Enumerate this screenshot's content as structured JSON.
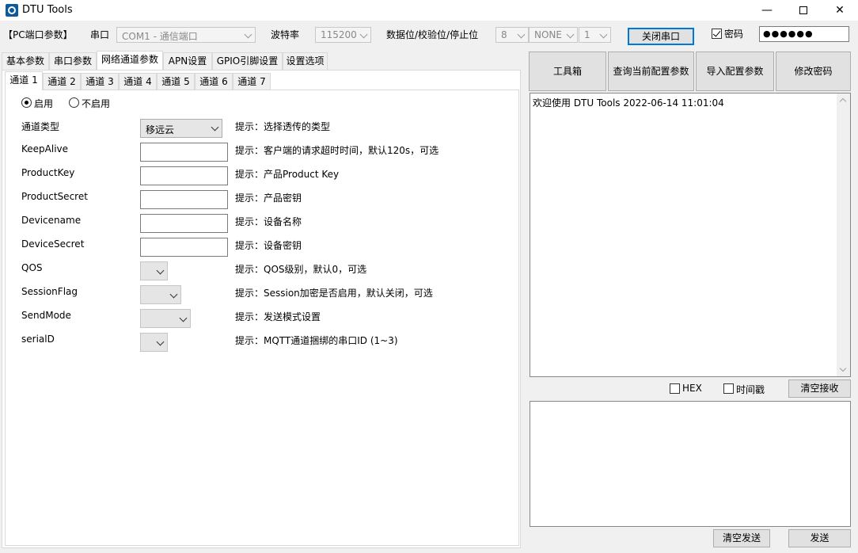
{
  "window": {
    "title": "DTU Tools"
  },
  "pc_port": {
    "section_label": "【PC端口参数】",
    "port_label": "串口",
    "port_value": "COM1 - 通信端口",
    "baud_label": "波特率",
    "baud_value": "115200",
    "format_label": "数据位/校验位/停止位",
    "data_bits": "8",
    "parity": "NONE",
    "stop_bits": "1",
    "close_port_button": "关闭串口",
    "password_checkbox_label": "密码",
    "password_checked": true,
    "password_value": "●●●●●●"
  },
  "main_tabs": [
    "基本参数",
    "串口参数",
    "网络通道参数",
    "APN设置",
    "GPIO引脚设置",
    "设置选项"
  ],
  "main_tab_selected": 2,
  "channel_tabs": [
    "通道 1",
    "通道 2",
    "通道 3",
    "通道 4",
    "通道 5",
    "通道 6",
    "通道 7"
  ],
  "channel_tab_selected": 0,
  "enable": {
    "on_label": "启用",
    "off_label": "不启用",
    "selected": "on"
  },
  "fields": [
    {
      "label": "通道类型",
      "type": "select",
      "value": "移远云",
      "hint": "提示：选择透传的类型"
    },
    {
      "label": "KeepAlive",
      "type": "text",
      "value": "",
      "hint": "提示：客户端的请求超时时间，默认120s，可选"
    },
    {
      "label": "ProductKey",
      "type": "text",
      "value": "",
      "hint": "提示：产品Product Key"
    },
    {
      "label": "ProductSecret",
      "type": "text",
      "value": "",
      "hint": "提示：产品密钥"
    },
    {
      "label": "Devicename",
      "type": "text",
      "value": "",
      "hint": "提示：设备名称"
    },
    {
      "label": "DeviceSecret",
      "type": "text",
      "value": "",
      "hint": "提示：设备密钥"
    },
    {
      "label": "QOS",
      "type": "select",
      "value": "",
      "hint": "提示：QOS级别，默认0，可选"
    },
    {
      "label": "SessionFlag",
      "type": "select",
      "value": "",
      "hint": "提示：Session加密是否启用，默认关闭，可选"
    },
    {
      "label": "SendMode",
      "type": "select",
      "value": "",
      "hint": "提示：发送模式设置"
    },
    {
      "label": "serialD",
      "type": "select",
      "value": "",
      "hint": "提示：MQTT通道捆绑的串口ID (1~3)"
    }
  ],
  "tools": {
    "toolbox": "工具箱",
    "query_config": "查询当前配置参数",
    "import_config": "导入配置参数",
    "change_password": "修改密码"
  },
  "log": {
    "text": "欢迎使用 DTU Tools 2022-06-14 11:01:04"
  },
  "receive_options": {
    "hex_label": "HEX",
    "hex_checked": false,
    "timestamp_label": "时间戳",
    "timestamp_checked": false,
    "clear_receive": "清空接收"
  },
  "send": {
    "value": "",
    "clear_send": "清空发送",
    "send_button": "发送"
  },
  "icons": [
    "app-icon",
    "minimize-icon",
    "maximize-icon",
    "close-icon",
    "chevron-down-icon",
    "scroll-up-icon",
    "scroll-down-icon"
  ]
}
